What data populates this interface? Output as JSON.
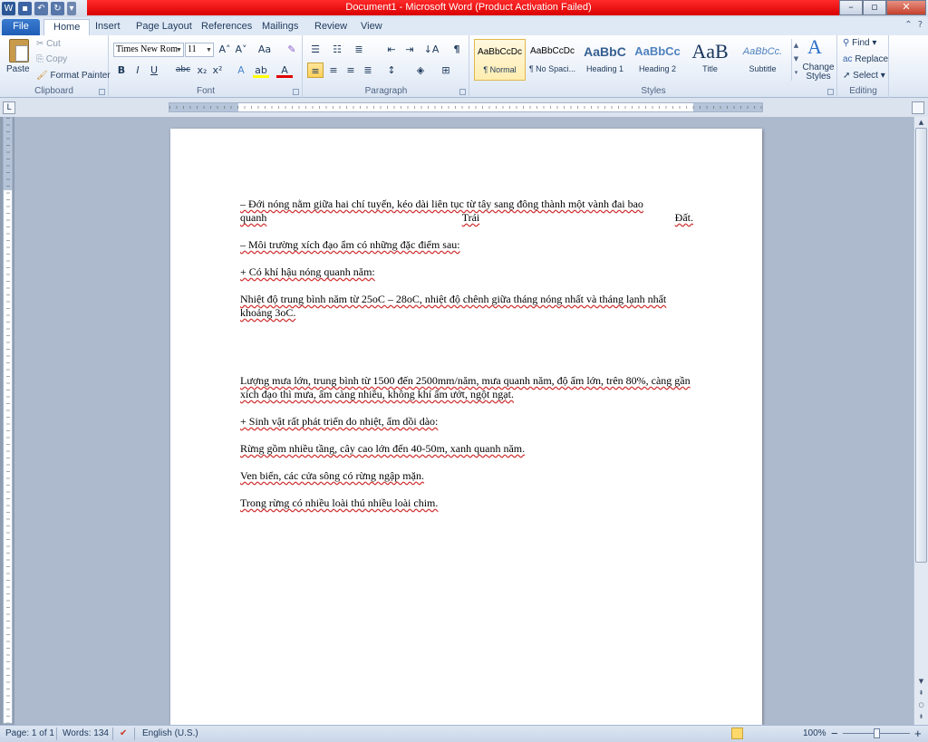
{
  "window": {
    "title": "Document1 - Microsoft Word (Product Activation Failed)",
    "min_symbol": "–",
    "max_symbol": "▫",
    "close_symbol": "✕"
  },
  "qat": {
    "word_icon": "W",
    "save_icon": "▪",
    "undo_icon": "↶",
    "redo_icon": "↻",
    "customize_icon": "▾"
  },
  "tabs": [
    "File",
    "Home",
    "Insert",
    "Page Layout",
    "References",
    "Mailings",
    "Review",
    "View"
  ],
  "help_icons": {
    "minimize_ribbon": "⌃",
    "help": "?"
  },
  "ribbon": {
    "clipboard": {
      "label": "Clipboard",
      "paste": "Paste",
      "cut": "Cut",
      "copy": "Copy",
      "format_painter": "Format Painter"
    },
    "font": {
      "label": "Font",
      "font_name": "Times New Rom",
      "font_size": "11",
      "bold": "B",
      "italic": "I",
      "underline": "U",
      "strike": "abc",
      "subscript": "x₂",
      "superscript": "x²",
      "grow": "A˄",
      "shrink": "A˅",
      "change_case": "Aa",
      "clear": "✎",
      "effects": "A",
      "highlight": "ab",
      "color": "A"
    },
    "paragraph": {
      "label": "Paragraph",
      "pilcrow": "¶",
      "sort": "↓A"
    },
    "styles": {
      "label": "Styles",
      "items": [
        {
          "sample": "AaBbCcDc",
          "name": "¶ Normal"
        },
        {
          "sample": "AaBbCcDc",
          "name": "¶ No Spaci..."
        },
        {
          "sample": "AaBbC",
          "name": "Heading 1"
        },
        {
          "sample": "AaBbCc",
          "name": "Heading 2"
        },
        {
          "sample": "AaB",
          "name": "Title"
        },
        {
          "sample": "AaBbCc.",
          "name": "Subtitle"
        }
      ],
      "change_styles": "Change Styles",
      "change_styles_icon": "A"
    },
    "editing": {
      "label": "Editing",
      "find": "Find",
      "replace": "Replace",
      "select": "Select"
    }
  },
  "document": {
    "para1_line1": "–  Đới nóng nằm giữa hai chí tuyến, kéo dài liên tục từ tây sang đông  thành một vành đai bao",
    "para1_line2": [
      "quanh",
      "Trái",
      "Đất."
    ],
    "para2": "–  Môi trường xích đạo ẩm có những đặc điểm sau:",
    "para3": "+ Có khí hậu nóng quanh năm:",
    "para4": "Nhiệt độ trung bình năm từ 25oC – 28oC, nhiệt độ chênh giữa tháng nóng nhất và tháng lạnh nhất khoảng 3oC.",
    "para5": "Lượng mưa lớn, trung bình từ 1500 đến 2500mm/năm, mưa quanh năm, độ ẩm lớn, trên 80%, càng gần xích đạo thì mưa, ẩm càng nhiều, không khí ẩm ướt, ngột ngạt.",
    "para6": "+ Sinh vật rất phát triển do nhiệt, ẩm dồi dào:",
    "para7": "Rừng gồm nhiều tầng, cây cao lớn đến 40-50m, xanh quanh năm.",
    "para8": "Ven biển, các cửa sông có rừng ngập mặn.",
    "para9": "Trong rừng có nhiều loài thú nhiều loài chim."
  },
  "statusbar": {
    "page": "Page: 1 of 1",
    "words": "Words: 134",
    "language": "English (U.S.)",
    "zoom": "100%",
    "zoom_minus": "−",
    "zoom_plus": "+"
  },
  "colors": {
    "title_red": "#e00000",
    "ribbon_bg": "#dfe9f5",
    "workspace": "#adb9cd",
    "file_tab": "#2a6bc4"
  }
}
